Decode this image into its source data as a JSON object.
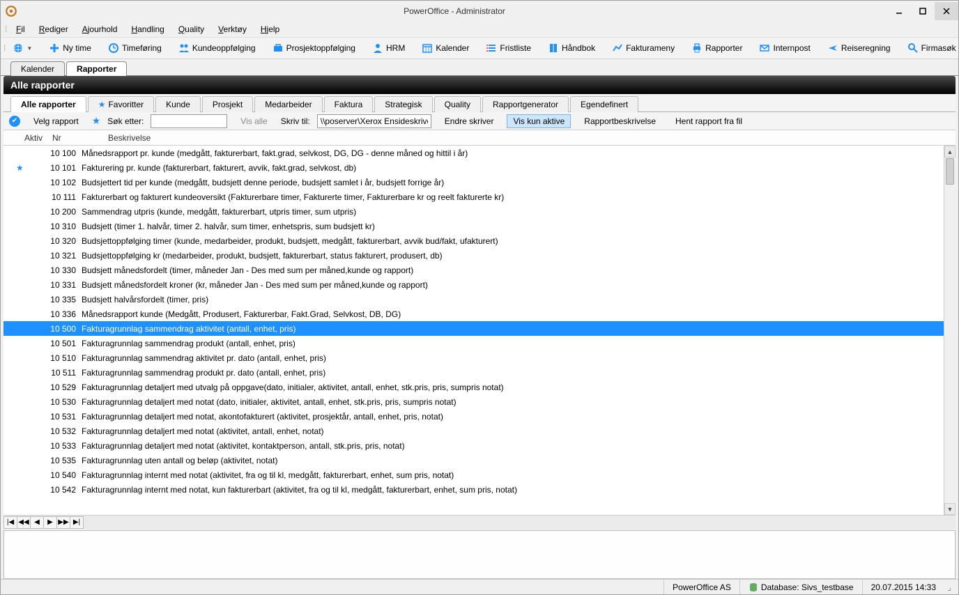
{
  "window": {
    "title": "PowerOffice - Administrator"
  },
  "menu": {
    "items": [
      "Fil",
      "Rediger",
      "Ajourhold",
      "Handling",
      "Quality",
      "Verktøy",
      "Hjelp"
    ]
  },
  "toolbar": {
    "globe": "",
    "items": [
      {
        "icon": "plus",
        "label": "Ny time"
      },
      {
        "icon": "clock",
        "label": "Timeføring"
      },
      {
        "icon": "people",
        "label": "Kundeoppfølging"
      },
      {
        "icon": "briefcase",
        "label": "Prosjektoppfølging"
      },
      {
        "icon": "person",
        "label": "HRM"
      },
      {
        "icon": "calendar",
        "label": "Kalender"
      },
      {
        "icon": "list",
        "label": "Fristliste"
      },
      {
        "icon": "book",
        "label": "Håndbok"
      },
      {
        "icon": "chart",
        "label": "Fakturameny"
      },
      {
        "icon": "printer",
        "label": "Rapporter"
      },
      {
        "icon": "mail",
        "label": "Internpost"
      },
      {
        "icon": "plane",
        "label": "Reiseregning"
      },
      {
        "icon": "search",
        "label": "Firmasøk"
      }
    ]
  },
  "doctabs": {
    "tabs": [
      {
        "label": "Kalender",
        "active": false
      },
      {
        "label": "Rapporter",
        "active": true
      }
    ]
  },
  "blackhead": "Alle rapporter",
  "rpttabs": [
    {
      "label": "Alle rapporter",
      "active": true
    },
    {
      "label": "Favoritter",
      "fav": true
    },
    {
      "label": "Kunde"
    },
    {
      "label": "Prosjekt"
    },
    {
      "label": "Medarbeider"
    },
    {
      "label": "Faktura"
    },
    {
      "label": "Strategisk"
    },
    {
      "label": "Quality"
    },
    {
      "label": "Rapportgenerator"
    },
    {
      "label": "Egendefinert"
    }
  ],
  "actionbar": {
    "velg": "Velg rapport",
    "sok_label": "Søk etter:",
    "sok_value": "",
    "vis_alle": "Vis alle",
    "skriv_label": "Skriv til:",
    "skriv_value": "\\\\poserver\\Xerox Ensideskriver",
    "endre": "Endre skriver",
    "vis_aktive": "Vis kun aktive",
    "beskrivelse": "Rapportbeskrivelse",
    "hent": "Hent rapport fra fil"
  },
  "columns": {
    "aktiv": "Aktiv",
    "nr": "Nr",
    "besk": "Beskrivelse"
  },
  "rows": [
    {
      "star": false,
      "nr": "10 100",
      "besk": "Månedsrapport pr. kunde (medgått, fakturerbart, fakt.grad, selvkost, DG, DG - denne måned og hittil i år)"
    },
    {
      "star": true,
      "nr": "10 101",
      "besk": "Fakturering pr. kunde (fakturerbart, fakturert, avvik, fakt.grad, selvkost, db)"
    },
    {
      "star": false,
      "nr": "10 102",
      "besk": "Budsjettert tid per kunde (medgått, budsjett denne periode, budsjett samlet i år, budsjett forrige år)"
    },
    {
      "star": false,
      "nr": "10 111",
      "besk": "Fakturerbart og fakturert kundeoversikt (Fakturerbare timer, Fakturerte timer, Fakturerbare kr og reelt fakturerte kr)"
    },
    {
      "star": false,
      "nr": "10 200",
      "besk": "Sammendrag utpris (kunde, medgått, fakturerbart, utpris timer, sum utpris)"
    },
    {
      "star": false,
      "nr": "10 310",
      "besk": "Budsjett (timer 1. halvår, timer 2. halvår, sum timer, enhetspris, sum budsjett kr)"
    },
    {
      "star": false,
      "nr": "10 320",
      "besk": "Budsjettoppfølging timer (kunde, medarbeider, produkt, budsjett, medgått, fakturerbart, avvik bud/fakt, ufakturert)"
    },
    {
      "star": false,
      "nr": "10 321",
      "besk": "Budsjettoppfølging kr (medarbeider, produkt, budsjett, fakturerbart, status fakturert, produsert, db)"
    },
    {
      "star": false,
      "nr": "10 330",
      "besk": "Budsjett månedsfordelt (timer, måneder Jan - Des med sum per måned,kunde og rapport)"
    },
    {
      "star": false,
      "nr": "10 331",
      "besk": "Budsjett månedsfordelt kroner (kr, måneder Jan - Des med sum per måned,kunde og rapport)"
    },
    {
      "star": false,
      "nr": "10 335",
      "besk": "Budsjett halvårsfordelt (timer, pris)"
    },
    {
      "star": false,
      "nr": "10 336",
      "besk": "Månedsrapport kunde (Medgått, Produsert, Fakturerbar, Fakt.Grad, Selvkost, DB, DG)"
    },
    {
      "star": false,
      "nr": "10 500",
      "besk": "Fakturagrunnlag sammendrag aktivitet (antall, enhet, pris)",
      "selected": true
    },
    {
      "star": false,
      "nr": "10 501",
      "besk": "Fakturagrunnlag sammendrag produkt (antall, enhet, pris)"
    },
    {
      "star": false,
      "nr": "10 510",
      "besk": "Fakturagrunnlag sammendrag aktivitet pr. dato (antall, enhet, pris)"
    },
    {
      "star": false,
      "nr": "10 511",
      "besk": "Fakturagrunnlag sammendrag produkt pr. dato (antall, enhet, pris)"
    },
    {
      "star": false,
      "nr": "10 529",
      "besk": "Fakturagrunnlag detaljert med utvalg på oppgave(dato, initialer, aktivitet, antall, enhet, stk.pris, pris, sumpris notat)"
    },
    {
      "star": false,
      "nr": "10 530",
      "besk": "Fakturagrunnlag detaljert med notat (dato, initialer, aktivitet, antall, enhet, stk.pris, pris, sumpris notat)"
    },
    {
      "star": false,
      "nr": "10 531",
      "besk": "Fakturagrunnlag detaljert med notat, akontofakturert (aktivitet, prosjektår, antall, enhet, pris, notat)"
    },
    {
      "star": false,
      "nr": "10 532",
      "besk": "Fakturagrunnlag detaljert med notat (aktivitet, antall, enhet, notat)"
    },
    {
      "star": false,
      "nr": "10 533",
      "besk": "Fakturagrunnlag detaljert med notat (aktivitet, kontaktperson, antall, stk.pris, pris, notat)"
    },
    {
      "star": false,
      "nr": "10 535",
      "besk": "Fakturagrunnlag uten antall og beløp (aktivitet, notat)"
    },
    {
      "star": false,
      "nr": "10 540",
      "besk": "Fakturagrunnlag internt med notat (aktivitet, fra og til kl, medgått, fakturerbart, enhet, sum pris, notat)"
    },
    {
      "star": false,
      "nr": "10 542",
      "besk": "Fakturagrunnlag internt med notat, kun fakturerbart (aktivitet, fra og til kl, medgått, fakturerbart, enhet, sum pris, notat)"
    }
  ],
  "statusbar": {
    "company": "PowerOffice AS",
    "database": "Database: Sivs_testbase",
    "datetime": "20.07.2015  14:33"
  }
}
